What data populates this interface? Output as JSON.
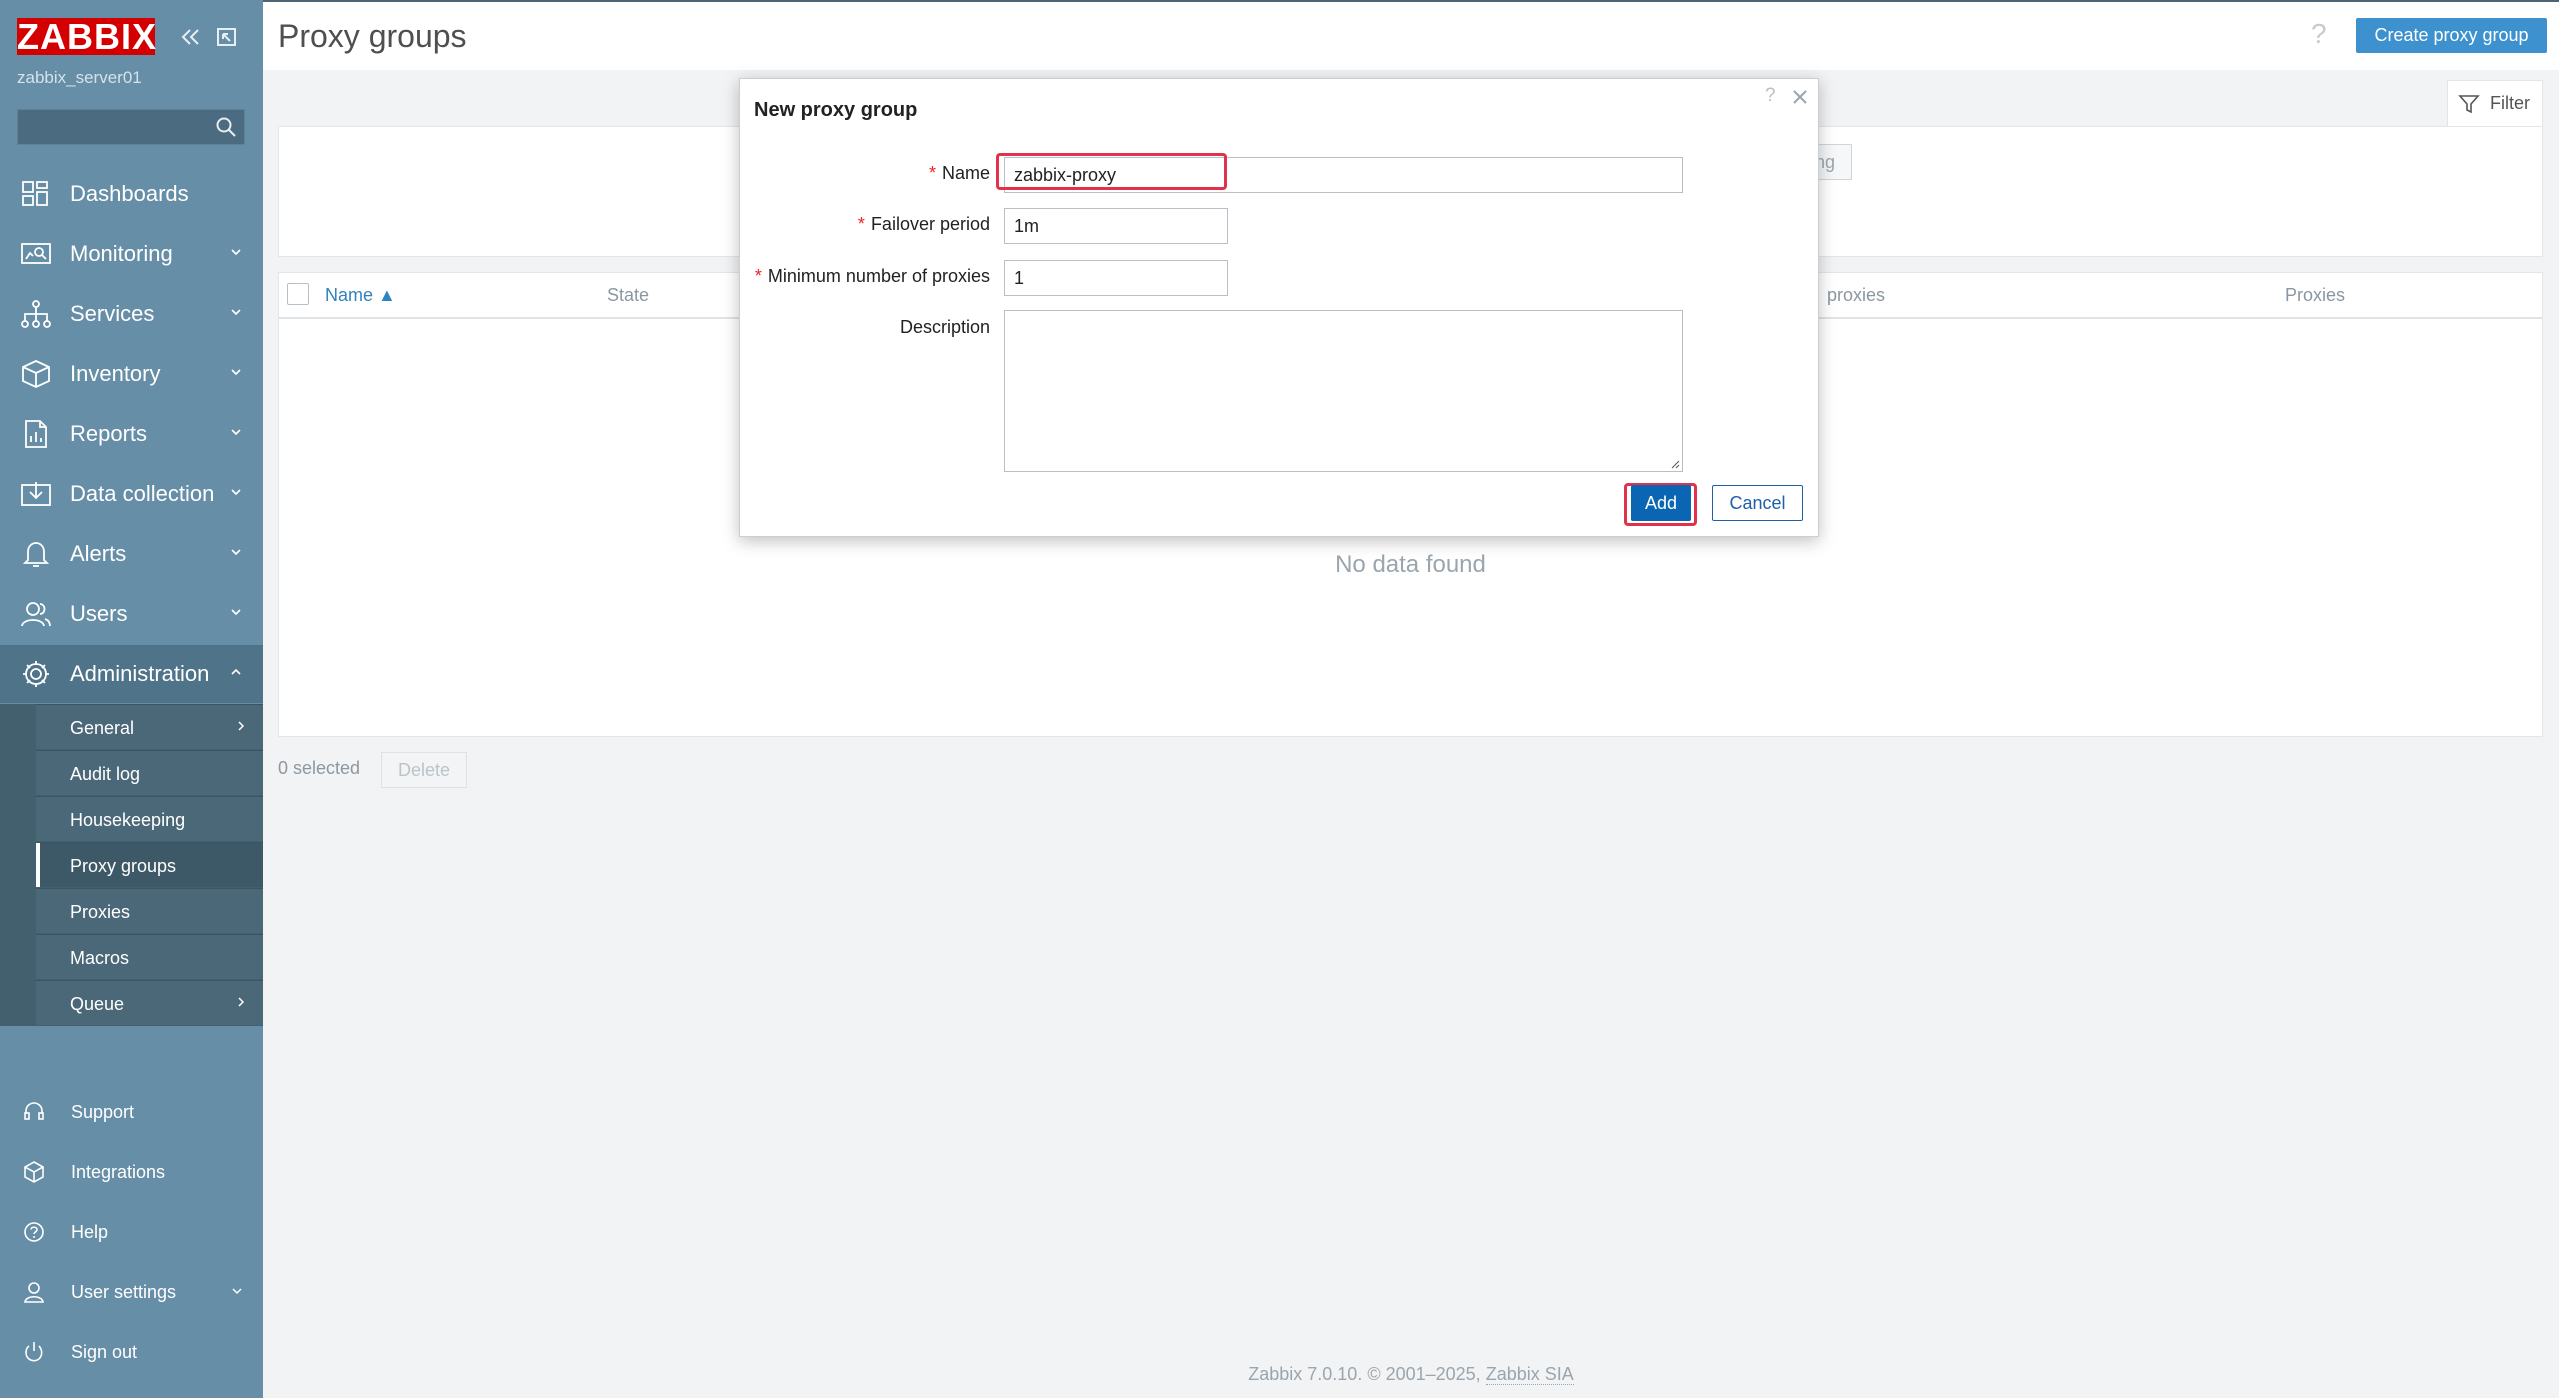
{
  "app": {
    "logo": "ZABBIX",
    "server": "zabbix_server01",
    "search_placeholder": ""
  },
  "nav": {
    "items": [
      {
        "label": "Dashboards",
        "icon": "dashboards-icon"
      },
      {
        "label": "Monitoring",
        "icon": "monitoring-icon"
      },
      {
        "label": "Services",
        "icon": "services-icon"
      },
      {
        "label": "Inventory",
        "icon": "inventory-icon"
      },
      {
        "label": "Reports",
        "icon": "reports-icon"
      },
      {
        "label": "Data collection",
        "icon": "data-collection-icon"
      },
      {
        "label": "Alerts",
        "icon": "alerts-icon"
      },
      {
        "label": "Users",
        "icon": "users-icon"
      },
      {
        "label": "Administration",
        "icon": "administration-icon"
      }
    ],
    "submenu": [
      {
        "label": "General"
      },
      {
        "label": "Audit log"
      },
      {
        "label": "Housekeeping"
      },
      {
        "label": "Proxy groups"
      },
      {
        "label": "Proxies"
      },
      {
        "label": "Macros"
      },
      {
        "label": "Queue"
      }
    ],
    "bottom": [
      {
        "label": "Support",
        "icon": "support-icon"
      },
      {
        "label": "Integrations",
        "icon": "integrations-icon"
      },
      {
        "label": "Help",
        "icon": "help-icon"
      },
      {
        "label": "User settings",
        "icon": "user-settings-icon"
      },
      {
        "label": "Sign out",
        "icon": "sign-out-icon"
      }
    ]
  },
  "page": {
    "title": "Proxy groups",
    "help": "?",
    "create_button": "Create proxy group",
    "filter_label": "Filter",
    "filter_button_fragment": "ng",
    "columns": [
      "Name ▲",
      "State",
      "proxies",
      "Proxies"
    ],
    "no_data": "No data found",
    "selected_count": "0 selected",
    "delete_button": "Delete"
  },
  "dialog": {
    "title": "New proxy group",
    "help": "?",
    "name_label": "Name",
    "name_value": "zabbix-proxy",
    "failover_label": "Failover period",
    "failover_value": "1m",
    "min_proxies_label": "Minimum number of proxies",
    "min_proxies_value": "1",
    "description_label": "Description",
    "description_value": "",
    "required_mark": "*",
    "add_button": "Add",
    "cancel_button": "Cancel"
  },
  "footer": {
    "text": "Zabbix 7.0.10. © 2001–2025,",
    "link": "Zabbix SIA"
  }
}
